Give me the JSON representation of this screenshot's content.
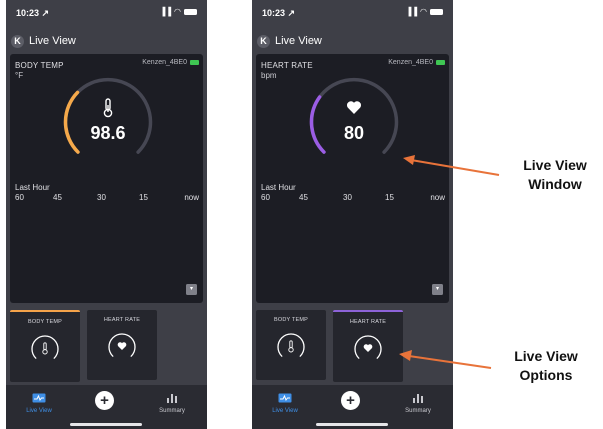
{
  "status_bar": {
    "time": "10:23",
    "location_glyph": "↗",
    "signal": "▐▐",
    "wifi": "◠"
  },
  "nav": {
    "back_glyph": "K",
    "title": "Live View"
  },
  "left_phone": {
    "metric_name": "BODY TEMP",
    "unit": "°F",
    "device": "Kenzen_4BE0",
    "value": "98.6",
    "gauge_fraction": 0.33,
    "gauge_color": "#f5a94a",
    "icon": "thermometer-icon"
  },
  "right_phone": {
    "metric_name": "HEART RATE",
    "unit": "bpm",
    "device": "Kenzen_4BE0",
    "value": "80",
    "gauge_fraction": 0.3,
    "gauge_color": "#9b5de5",
    "icon": "heart-icon"
  },
  "chart": {
    "last_hour_label": "Last Hour",
    "axis_ticks": [
      "60",
      "45",
      "30",
      "15",
      "now"
    ]
  },
  "tiles": [
    {
      "label": "BODY TEMP",
      "icon": "thermometer-icon"
    },
    {
      "label": "HEART RATE",
      "icon": "heart-icon"
    }
  ],
  "tabbar": {
    "live_view": "Live View",
    "summary": "Summary",
    "add_glyph": "+"
  },
  "dropdown_glyph": "▾",
  "annotations": {
    "window_line1": "Live View",
    "window_line2": "Window",
    "options_line1": "Live View",
    "options_line2": "Options",
    "arrow_color": "#e8733a"
  }
}
